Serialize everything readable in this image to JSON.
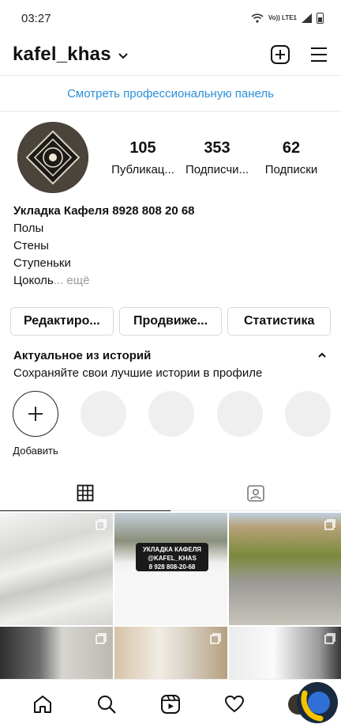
{
  "status_bar": {
    "time": "03:27",
    "network": "Vo)) LTE1"
  },
  "header": {
    "username": "kafel_khas",
    "icons": [
      "chevron-down-icon",
      "add-post-icon",
      "menu-icon"
    ]
  },
  "pro_banner": {
    "label": "Смотреть профессиональную панель",
    "color": "#2a8fd8"
  },
  "stats": {
    "posts": {
      "value": "105",
      "label": "Публикац..."
    },
    "followers": {
      "value": "353",
      "label": "Подписчи..."
    },
    "following": {
      "value": "62",
      "label": "Подписки"
    }
  },
  "bio": {
    "name_line": "Укладка Кафеля 8928 808 20 68",
    "lines": [
      "Полы",
      "Стены",
      "Ступеньки"
    ],
    "last_line": "Цоколь",
    "more": "... ещё"
  },
  "buttons": {
    "edit": "Редактиро...",
    "promote": "Продвиже...",
    "stats": "Статистика"
  },
  "highlights": {
    "title": "Актуальное из историй",
    "subtitle": "Сохраняйте свои лучшие истории в профиле",
    "add_label": "Добавить"
  },
  "tabs": [
    {
      "name": "grid",
      "icon": "grid-icon",
      "active": true
    },
    {
      "name": "tagged",
      "icon": "tagged-icon",
      "active": false
    }
  ],
  "posts": {
    "car_text_1": "УКЛАДКА КАФЕЛЯ",
    "car_text_2": "@KAFEL_KHAS",
    "car_text_3": "8 928 808-20-68"
  },
  "bottom_nav": [
    "home-icon",
    "search-icon",
    "reels-icon",
    "heart-icon",
    "profile-avatar"
  ]
}
